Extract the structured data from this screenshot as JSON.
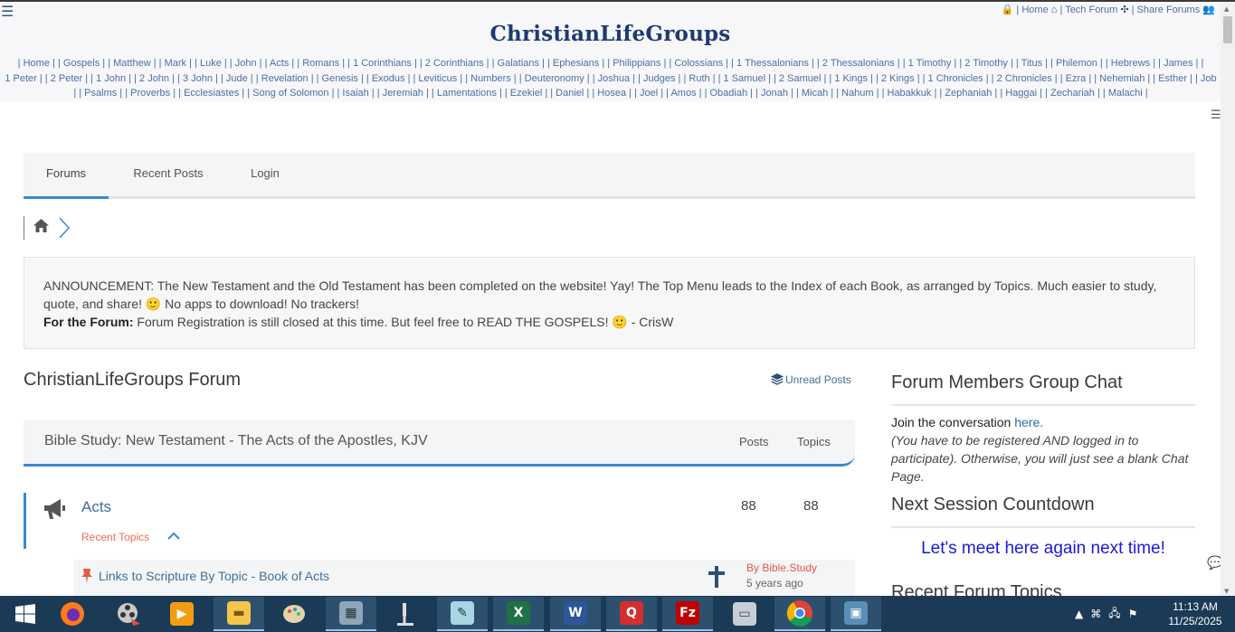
{
  "header": {
    "menu_icon": "hamburger-icon",
    "links": [
      {
        "label": "Home",
        "icon": "home-icon"
      },
      {
        "label": "Tech Forum",
        "icon": "puzzle-icon"
      },
      {
        "label": "Share Forums",
        "icon": "users-icon"
      }
    ],
    "logo_text": "ChristianLifeGroups",
    "book_nav": [
      "Home",
      "Gospels",
      "Matthew",
      "Mark",
      "Luke",
      "John",
      "Acts",
      "Romans",
      "1 Corinthians",
      "2 Corinthians",
      "Galatians",
      "Ephesians",
      "Philippians",
      "Colossians",
      "1 Thessalonians",
      "2 Thessalonians",
      "1 Timothy",
      "2 Timothy",
      "Titus",
      "Philemon",
      "Hebrews",
      "James",
      "1 Peter",
      "2 Peter",
      "1 John",
      "2 John",
      "3 John",
      "Jude",
      "Revelation",
      "Genesis",
      "Exodus",
      "Leviticus",
      "Numbers",
      "Deuteronomy",
      "Joshua",
      "Judges",
      "Ruth",
      "1 Samuel",
      "2 Samuel",
      "1 Kings",
      "2 Kings",
      "1 Chronicles",
      "2 Chronicles",
      "Ezra",
      "Nehemiah",
      "Esther",
      "Job",
      "Psalms",
      "Proverbs",
      "Ecclesiastes",
      "Song of Solomon",
      "Isaiah",
      "Jeremiah",
      "Lamentations",
      "Ezekiel",
      "Daniel",
      "Hosea",
      "Joel",
      "Amos",
      "Obadiah",
      "Jonah",
      "Micah",
      "Nahum",
      "Habakkuk",
      "Zephaniah",
      "Haggai",
      "Zechariah",
      "Malachi"
    ]
  },
  "tabs": [
    "Forums",
    "Recent Posts",
    "Login"
  ],
  "announcement": {
    "line1": "ANNOUNCEMENT:  The New Testament and the Old Testament has been completed on the website!  Yay!  The Top Menu leads to the Index of each Book, as  arranged by Topics.  Much easier to study, quote, and share!  🙂 No apps to download! No trackers!",
    "forum_label": "For the Forum:",
    "line2": " Forum Registration is still closed at this time.  But feel free to READ THE GOSPELS!  🙂 - CrisW"
  },
  "forum": {
    "title": "ChristianLifeGroups Forum",
    "unread_label": "Unread Posts",
    "category": "Bible Study: New Testament - The Acts of the Apostles, KJV",
    "col_posts": "Posts",
    "col_topics": "Topics",
    "row": {
      "name": "Acts",
      "posts": "88",
      "topics": "88",
      "recent_label": "Recent Topics"
    },
    "topic": {
      "title": "Links to Scripture By Topic - Book of Acts",
      "author": "By Bible.Study",
      "time": "5 years ago"
    }
  },
  "sidebar": {
    "chat_heading": "Forum Members Group Chat",
    "chat_join": "Join the conversation ",
    "chat_link": "here.",
    "chat_note": "(You have to be registered AND logged in to participate).  Otherwise, you will just see a blank Chat Page.",
    "countdown_heading": "Next Session Countdown",
    "countdown_msg": "Let's meet here again next time!",
    "recent_heading": "Recent Forum Topics"
  },
  "taskbar": {
    "apps": [
      "start",
      "firefox",
      "media-player",
      "video",
      "file-explorer",
      "paint",
      "calculator",
      "microscope",
      "notepad",
      "excel",
      "word",
      "qgis",
      "filezilla",
      "system-monitor",
      "chrome",
      "photos"
    ],
    "time": "11:13 AM",
    "date": "11/25/2025"
  },
  "colors": {
    "accent": "#3a8ad0",
    "link": "#3f6f99",
    "logo": "#1e3a72",
    "countdown": "#1a1ad6",
    "recent_topics": "#e76f51"
  }
}
